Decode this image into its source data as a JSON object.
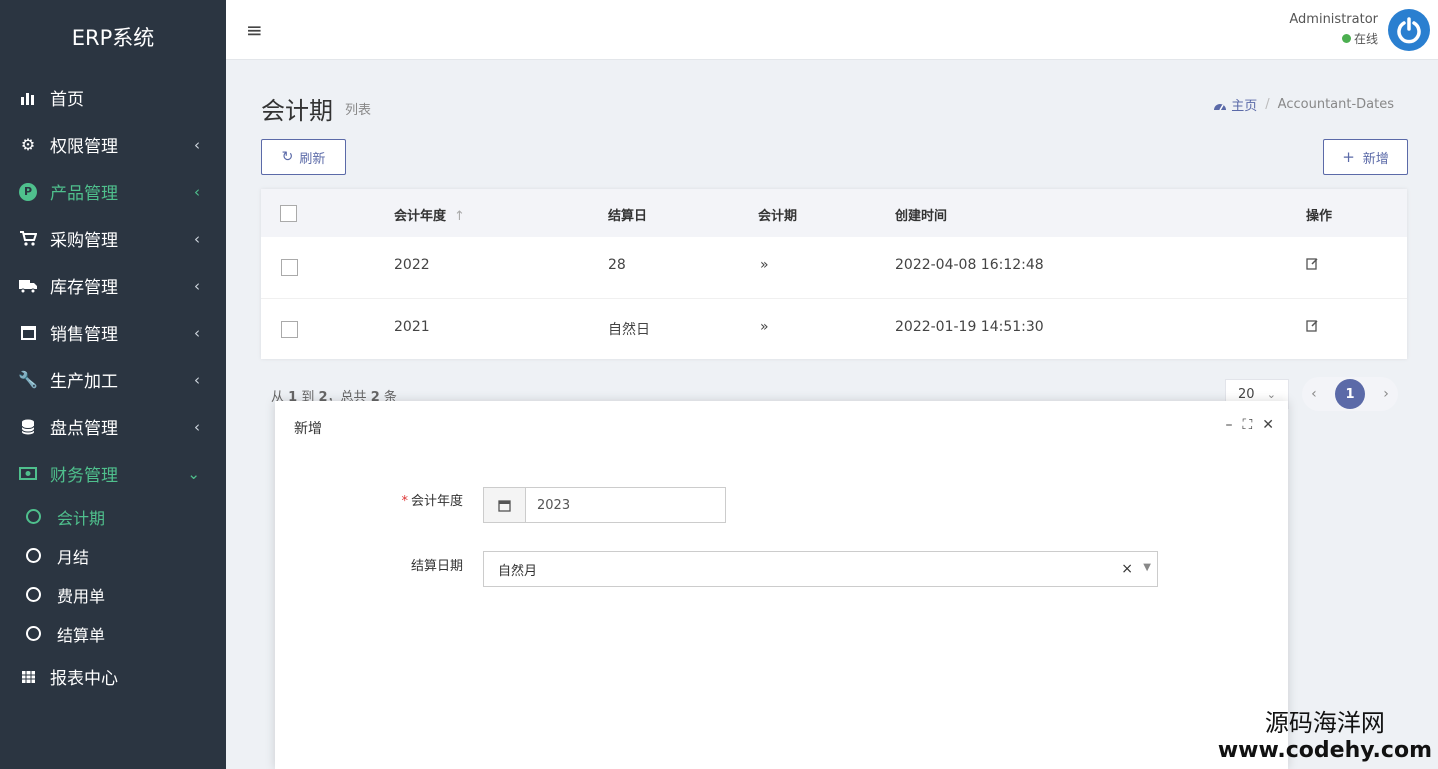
{
  "app": {
    "brand": "ERP系统"
  },
  "sidebar": {
    "items": [
      {
        "label": "首页",
        "icon": "bar-chart-icon"
      },
      {
        "label": "权限管理",
        "icon": "gear-icon"
      },
      {
        "label": "产品管理",
        "icon": "p-badge-icon",
        "badge": "P"
      },
      {
        "label": "采购管理",
        "icon": "cart-icon"
      },
      {
        "label": "库存管理",
        "icon": "truck-icon"
      },
      {
        "label": "销售管理",
        "icon": "calendar-icon"
      },
      {
        "label": "生产加工",
        "icon": "wrench-icon"
      },
      {
        "label": "盘点管理",
        "icon": "database-icon"
      },
      {
        "label": "财务管理",
        "icon": "money-icon"
      },
      {
        "label": "报表中心",
        "icon": "calendar-grid-icon"
      }
    ],
    "finance_sub": [
      {
        "label": "会计期"
      },
      {
        "label": "月结"
      },
      {
        "label": "费用单"
      },
      {
        "label": "结算单"
      }
    ],
    "accent_color": "#4fc08d"
  },
  "header": {
    "user_name": "Administrator",
    "user_status": "在线"
  },
  "page": {
    "title": "会计期",
    "subtitle": "列表",
    "breadcrumb_home": "主页",
    "breadcrumb_current": "Accountant-Dates",
    "refresh_label": "刷新",
    "add_label": "新增"
  },
  "table": {
    "headers": [
      "会计年度",
      "结算日",
      "会计期",
      "创建时间",
      "操作"
    ],
    "rows": [
      {
        "year": "2022",
        "settle_day": "28",
        "period": "»",
        "created": "2022-04-08 16:12:48"
      },
      {
        "year": "2021",
        "settle_day": "自然日",
        "period": "»",
        "created": "2022-01-19 14:51:30"
      }
    ]
  },
  "pagination": {
    "summary_pre": "从",
    "from": "1",
    "summary_mid": "到",
    "to": "2",
    "summary_total_pre": "，总共",
    "total": "2",
    "summary_post": "条",
    "page_size": "20",
    "current_page": "1"
  },
  "modal": {
    "title": "新增",
    "fiscal_year_label": "会计年度",
    "fiscal_year_value": "2023",
    "settle_date_label": "结算日期",
    "settle_date_value": "自然月",
    "clear_symbol": "×"
  },
  "watermark": {
    "cn": "源码海洋网",
    "en": "www.codehy.com"
  },
  "colors": {
    "sidebar_bg": "#2b3541",
    "primary": "#5b6aa8"
  }
}
